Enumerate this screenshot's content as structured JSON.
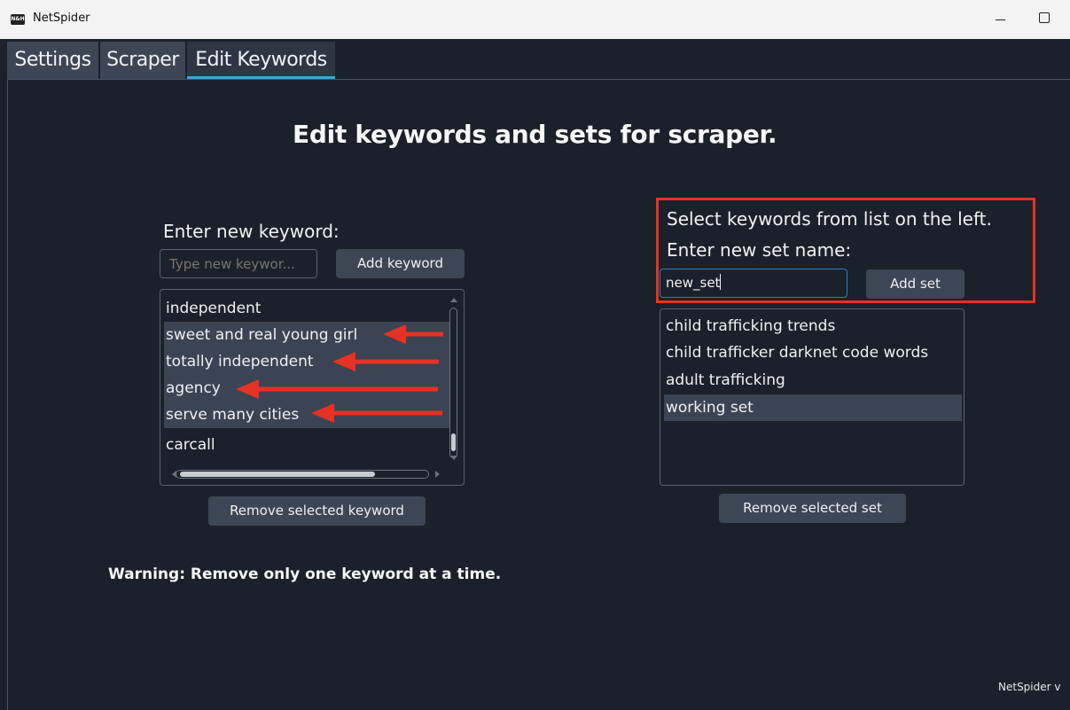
{
  "window": {
    "icon_text": "N&H",
    "title": "NetSpider"
  },
  "tabs": [
    "Settings",
    "Scraper",
    "Edit Keywords"
  ],
  "active_tab": "Edit Keywords",
  "heading": "Edit keywords and sets for scraper.",
  "keywords": {
    "label": "Enter new keyword:",
    "input_placeholder": "Type new keywor...",
    "input_value": "",
    "add_button": "Add keyword",
    "items": [
      {
        "text": "independent",
        "selected": false
      },
      {
        "text": "sweet and real young girl",
        "selected": true
      },
      {
        "text": "totally independent",
        "selected": true
      },
      {
        "text": "agency",
        "selected": true
      },
      {
        "text": "serve many cities",
        "selected": true
      },
      {
        "text": "carcall",
        "selected": false
      }
    ],
    "remove_button": "Remove selected keyword"
  },
  "sets": {
    "instruction": "Select keywords from list on the left.",
    "label": "Enter new set name:",
    "input_value": "new_set",
    "add_button": "Add set",
    "items": [
      {
        "text": "child trafficking trends",
        "selected": false
      },
      {
        "text": "child trafficker darknet code words",
        "selected": false
      },
      {
        "text": "adult trafficking",
        "selected": false
      },
      {
        "text": "working set",
        "selected": true
      }
    ],
    "remove_button": "Remove selected set"
  },
  "warning": "Warning: Remove only one keyword at a time.",
  "version": "NetSpider v",
  "colors": {
    "background": "#1b212a",
    "button": "#3d4654",
    "selection": "#3b4453",
    "tab_indicator": "#3aa5e0",
    "input_focus": "#2f7dbf",
    "annotation": "#e53224"
  }
}
